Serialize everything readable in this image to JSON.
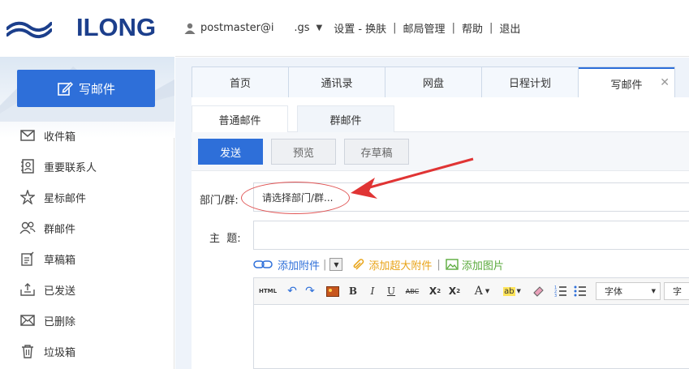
{
  "brand": {
    "name": "ILONG"
  },
  "sidebar": {
    "compose_label": "写邮件",
    "folders": [
      {
        "label": "收件箱",
        "icon": "envelope-icon"
      },
      {
        "label": "重要联系人",
        "icon": "contact-card-icon"
      },
      {
        "label": "星标邮件",
        "icon": "star-icon"
      },
      {
        "label": "群邮件",
        "icon": "group-icon"
      },
      {
        "label": "草稿箱",
        "icon": "draft-icon"
      },
      {
        "label": "已发送",
        "icon": "sent-tray-icon"
      },
      {
        "label": "已删除",
        "icon": "deleted-envelope-icon"
      },
      {
        "label": "垃圾箱",
        "icon": "trash-icon"
      }
    ]
  },
  "topbar": {
    "user": "postmaster@i      .gs",
    "links": [
      "设置 - 换肤",
      "邮局管理",
      "帮助",
      "退出"
    ]
  },
  "tabs": [
    {
      "label": "首页"
    },
    {
      "label": "通讯录"
    },
    {
      "label": "网盘"
    },
    {
      "label": "日程计划"
    },
    {
      "label": "写邮件"
    }
  ],
  "subtabs": [
    "普通邮件",
    "群邮件"
  ],
  "toolbar": {
    "send": "发送",
    "preview": "预览",
    "save_draft": "存草稿"
  },
  "form": {
    "dept_label": "部门/群:",
    "dept_placeholder": "请选择部门/群...",
    "subject_label": "主  题:",
    "subject_value": ""
  },
  "attachments": {
    "add_attachment": "添加附件",
    "add_large": "添加超大附件",
    "add_image": "添加图片",
    "sep": "|"
  },
  "editor": {
    "font_label": "字体",
    "font_size_label": "字"
  },
  "colors": {
    "accent": "#2e6fd9",
    "annotation": "#e03434",
    "brand": "#1c3f8c"
  }
}
